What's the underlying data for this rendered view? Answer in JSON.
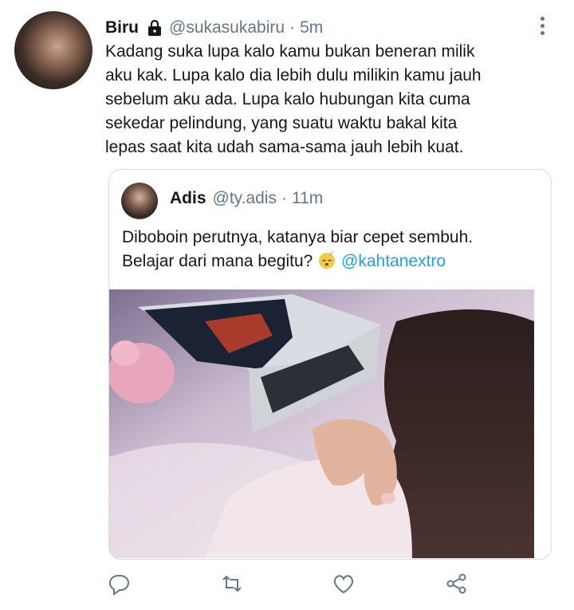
{
  "tweet": {
    "author_name": "Biru",
    "author_handle": "@sukasukabiru",
    "separator": "·",
    "time": "5m",
    "text_lines": [
      "Kadang suka lupa kalo kamu bukan beneran milik",
      "aku kak. Lupa kalo dia lebih dulu milikin kamu jauh",
      "sebelum aku ada. Lupa kalo hubungan kita cuma",
      "sekedar pelindung, yang suatu waktu bakal kita",
      "lepas saat kita udah sama-sama jauh lebih kuat."
    ]
  },
  "quote": {
    "author_name": "Adis",
    "author_handle": "@ty.adis",
    "separator": "·",
    "time": "11m",
    "line1": "Diboboin perutnya, katanya biar cepet sembuh.",
    "line2": "Belajar dari mana begitu?",
    "mention": "@kahtanextro"
  },
  "icons": {
    "lock": "lock-icon",
    "more": "more-vertical-icon",
    "reply": "reply-icon",
    "retweet": "retweet-icon",
    "like": "like-icon",
    "share": "share-icon",
    "emoji": "sleeping-face-emoji"
  },
  "colors": {
    "text": "#14171a",
    "secondary": "#657786",
    "link": "#1da1f2",
    "border": "#d9dee2"
  }
}
